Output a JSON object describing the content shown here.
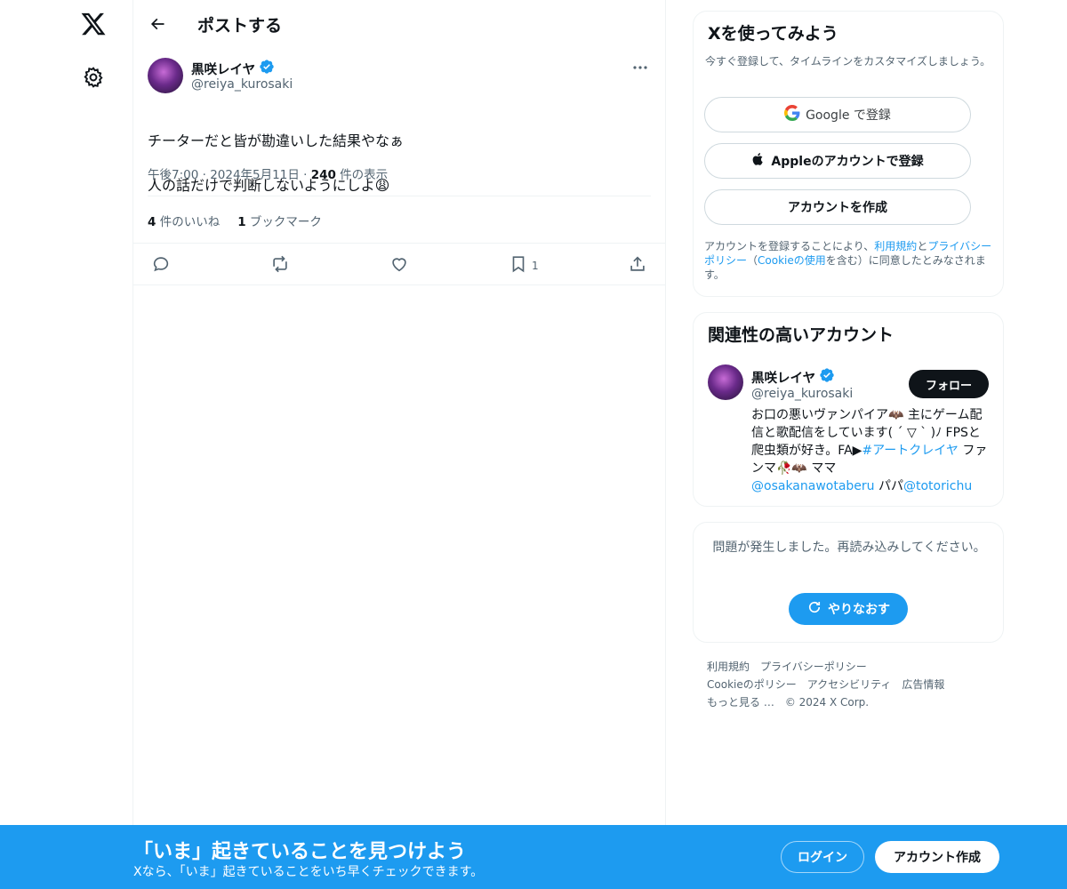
{
  "header": {
    "title": "ポストする"
  },
  "tweet": {
    "author_name": "黒咲レイヤ",
    "author_handle": "@reiya_kurosaki",
    "text_line1": "チーターだと皆が勘違いした結果やなぁ",
    "text_line2": "人の話だけで判断しないようにしよ😩",
    "time": "午後7:00 · 2024年5月11日 · ",
    "views_count": "240",
    "views_label": " 件の表示",
    "likes_count": "4",
    "likes_label": " 件のいいね",
    "bookmarks_count": "1",
    "bookmarks_label": " ブックマーク",
    "bookmark_action_count": "1"
  },
  "try_card": {
    "title": "Xを使ってみよう",
    "subtitle": "今すぐ登録して、タイムラインをカスタマイズしましょう。",
    "google_label": "Google で登録",
    "apple_label": "Appleのアカウントで登録",
    "create_label": "アカウントを作成",
    "terms_prefix": "アカウントを登録することにより、",
    "terms_link": "利用規約",
    "terms_and": "と",
    "privacy_link": "プライバシーポリシー",
    "cookie_open": "（",
    "cookie_link": "Cookieの使用",
    "terms_suffix": "を含む）に同意したとみなされます。"
  },
  "related_card": {
    "title": "関連性の高いアカウント",
    "name": "黒咲レイヤ",
    "handle": "@reiya_kurosaki",
    "follow_label": "フォロー",
    "bio_part1": "お口の悪いヴァンパイア🦇 主にゲーム配信と歌配信をしています( ´ ▽ ` )ﾉ FPSと爬虫類が好き。FA▶",
    "bio_tag": "#アートクレイヤ",
    "bio_part2": " ファンマ🥀🦇 ママ",
    "bio_mention1": "@osakanawotaberu",
    "bio_part3": " パパ",
    "bio_mention2": "@totorichu"
  },
  "error_card": {
    "message": "問題が発生しました。再読み込みしてください。",
    "retry_label": "やりなおす"
  },
  "footer": {
    "terms": "利用規約",
    "privacy": "プライバシーポリシー",
    "cookie": "Cookieのポリシー",
    "accessibility": "アクセシビリティ",
    "ads": "広告情報",
    "more": "もっと見る …",
    "copyright": "© 2024 X Corp."
  },
  "banner": {
    "title": "「いま」起きていることを見つけよう",
    "subtitle": "Xなら、「いま」起きていることをいち早くチェックできます。",
    "login_label": "ログイン",
    "signup_label": "アカウント作成"
  },
  "colors": {
    "accent": "#1d9bf0",
    "text": "#0f1419",
    "muted": "#536471",
    "border": "#eff3f4"
  },
  "icons": [
    "x-logo-icon",
    "gear-icon",
    "back-arrow-icon",
    "verified-badge-icon",
    "more-icon",
    "reply-icon",
    "repost-icon",
    "like-icon",
    "bookmark-icon",
    "share-icon",
    "google-icon",
    "apple-icon",
    "refresh-icon"
  ]
}
